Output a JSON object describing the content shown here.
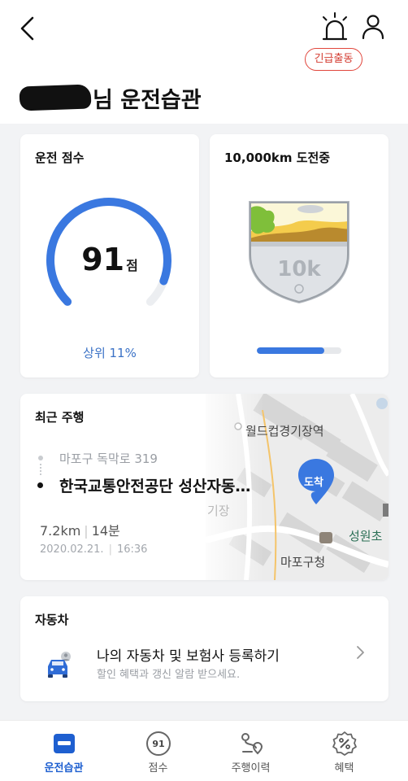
{
  "header": {
    "emergency_label": "긴급출동",
    "title": "님 운전습관"
  },
  "score_card": {
    "title": "운전 점수",
    "score": "91",
    "score_value": 91,
    "score_max": 100,
    "unit": "점",
    "rank": "상위 11%"
  },
  "challenge_card": {
    "title": "10,000km 도전중",
    "badge_text": "10k",
    "progress": 0.8
  },
  "recent_trip": {
    "title": "최근 주행",
    "from": "마포구 독막로 319",
    "to": "한국교통안전공단 성산자동…",
    "distance": "7.2km",
    "duration": "14분",
    "date": "2020.02.21.",
    "time": "16:36",
    "map": {
      "label_station": "월드컵경기장역",
      "label_arrival": "도착",
      "label_district": "마포구청",
      "label_school": "성원초",
      "label_partial": "기장"
    }
  },
  "car_card": {
    "title": "자동차",
    "register": "나의 자동차 및 보험사 등록하기",
    "register_sub": "할인 혜택과 갱신 알람 받으세요."
  },
  "tabs": [
    {
      "label": "운전습관",
      "icon": "driving-habit-icon",
      "active": true
    },
    {
      "label": "점수",
      "icon": "score-icon",
      "badge": "91"
    },
    {
      "label": "주행이력",
      "icon": "route-history-icon"
    },
    {
      "label": "혜택",
      "icon": "benefit-icon"
    }
  ],
  "colors": {
    "accent": "#3a78e0",
    "emergency": "#e1463c",
    "rank_text": "#3b72c6",
    "tab_active": "#1e5fd0"
  }
}
